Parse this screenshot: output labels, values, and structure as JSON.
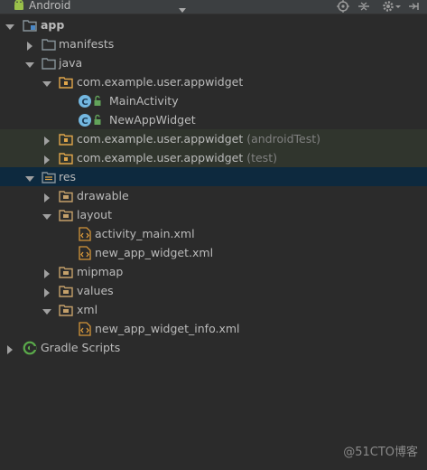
{
  "toolbar": {
    "view_mode": "Android",
    "view_mode_icon": "android-icon",
    "actions": [
      "target-icon",
      "collapse-all-icon",
      "gear-icon",
      "hide-icon"
    ]
  },
  "tree": {
    "app": "app",
    "manifests": "manifests",
    "java": "java",
    "pkg_main": "com.example.user.appwidget",
    "class_main_activity": "MainActivity",
    "class_new_app_widget": "NewAppWidget",
    "pkg_android_test": "com.example.user.appwidget",
    "pkg_android_test_suffix": "(androidTest)",
    "pkg_test": "com.example.user.appwidget",
    "pkg_test_suffix": "(test)",
    "res": "res",
    "drawable": "drawable",
    "layout": "layout",
    "activity_main_xml": "activity_main.xml",
    "new_app_widget_xml": "new_app_widget.xml",
    "mipmap": "mipmap",
    "values": "values",
    "xml": "xml",
    "new_app_widget_info_xml": "new_app_widget_info.xml",
    "gradle_scripts": "Gradle Scripts"
  },
  "colors": {
    "background": "#2b2b2b",
    "toolbar": "#3c3f41",
    "text": "#bbbbbb",
    "suffix": "#808080",
    "selected_row": "#0d293e",
    "test_row": "#30352d",
    "folder": "#87939a",
    "package_folder": "#e0a64b",
    "class_icon": "#73b7e0"
  },
  "watermark": "@51CTO博客"
}
